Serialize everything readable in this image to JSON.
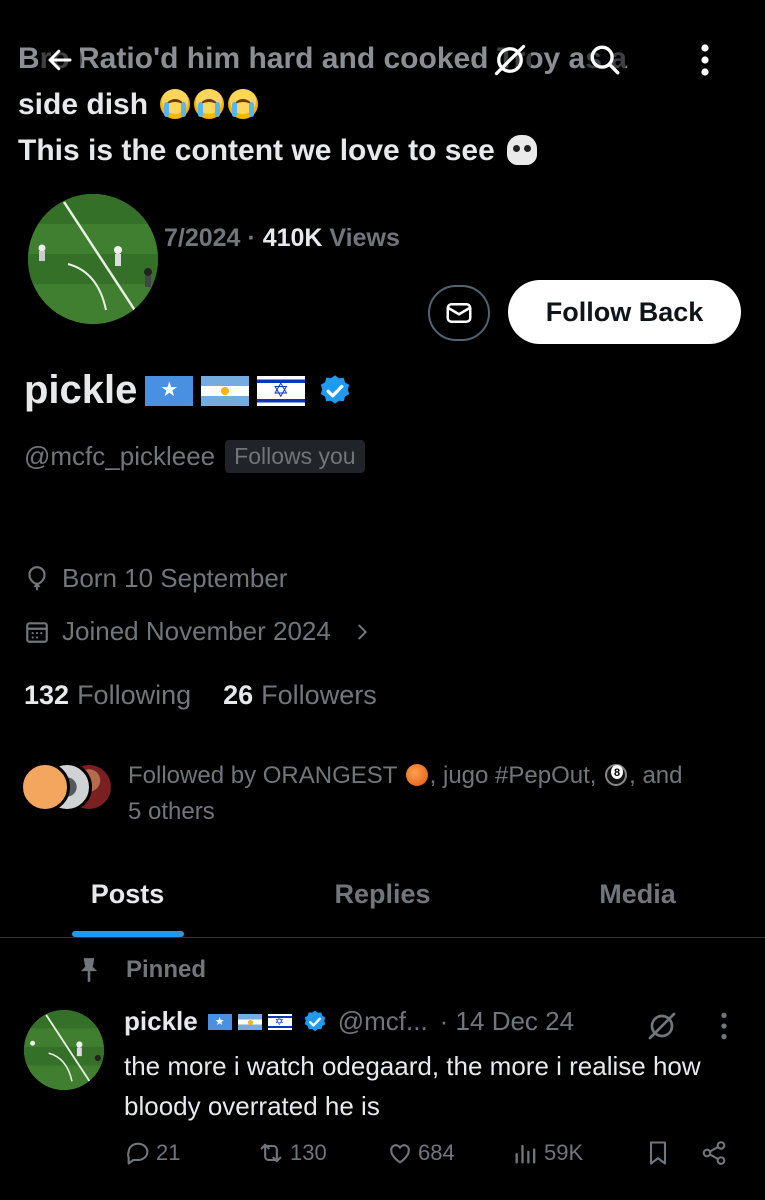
{
  "background_tweet": {
    "line1": "Bro Ratio'd him hard and cooked Troy as a",
    "line2": "side dish",
    "line3": "This is the content we love to see"
  },
  "views": {
    "date_fragment": "7/2024 ·",
    "count": "410K",
    "label": "Views"
  },
  "actions": {
    "follow_back_label": "Follow Back"
  },
  "profile": {
    "display_name": "pickle",
    "handle": "@mcfc_pickleee",
    "follows_you": "Follows you",
    "born": "Born 10 September",
    "joined": "Joined November 2024",
    "following_count": "132",
    "following_label": "Following",
    "followers_count": "26",
    "followers_label": "Followers",
    "followed_by_prefix": "Followed by ORANGEST",
    "followed_by_mid": ", jugo #PepOut,",
    "followed_by_suffix": ", and",
    "followed_by_others": "5 others"
  },
  "tabs": [
    {
      "label": "Posts",
      "active": true
    },
    {
      "label": "Replies",
      "active": false
    },
    {
      "label": "Media",
      "active": false
    }
  ],
  "pinned_post": {
    "pinned_label": "Pinned",
    "author": "pickle",
    "handle": "@mcf...",
    "date": "· 14 Dec 24",
    "text": "the more i watch odegaard, the more i realise how bloody overrated he is",
    "replies": "21",
    "reposts": "130",
    "likes": "684",
    "views": "59K"
  },
  "colors": {
    "background": "#000000",
    "text_primary": "#e7e9ea",
    "text_secondary": "#71767b",
    "accent": "#1d9bf0",
    "verified": "#1d9bf0"
  },
  "icons": [
    "back-arrow-icon",
    "no-view-icon",
    "search-icon",
    "more-vertical-icon",
    "envelope-icon",
    "verified-badge-icon",
    "location-icon",
    "calendar-icon",
    "chevron-right-icon",
    "pin-icon",
    "reply-icon",
    "repost-icon",
    "like-icon",
    "views-icon",
    "bookmark-icon",
    "share-icon"
  ]
}
